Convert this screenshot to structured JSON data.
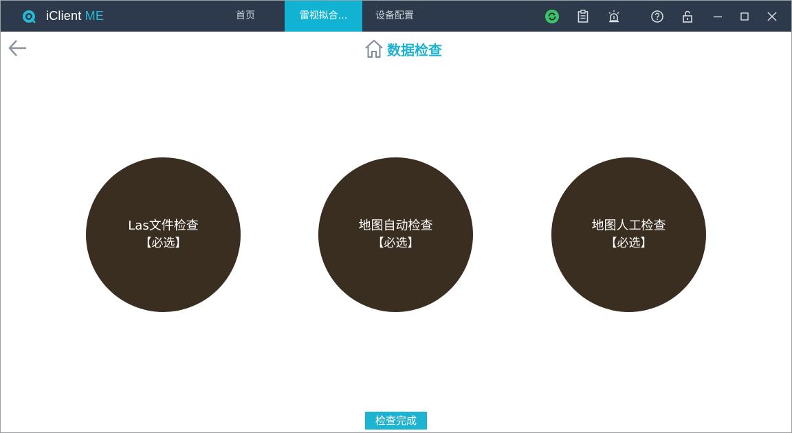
{
  "app": {
    "name_main": "iClient",
    "name_accent": "ME"
  },
  "tabs": [
    {
      "label": "首页",
      "active": false
    },
    {
      "label": "雷视拟合...",
      "active": true
    },
    {
      "label": "设备配置",
      "active": false
    }
  ],
  "toolbar_icons": [
    "sync-icon",
    "clipboard-icon",
    "alarm-icon",
    "help-icon",
    "lock-icon",
    "minimize-icon",
    "maximize-icon",
    "close-icon"
  ],
  "colors": {
    "titlebar": "#2c3a4b",
    "accent": "#1eb3d1",
    "circle": "#3a2e20",
    "sync_green": "#3cc36b"
  },
  "page": {
    "title": "数据检查"
  },
  "checks": [
    {
      "label": "Las文件检查",
      "sub": "【必选】"
    },
    {
      "label": "地图自动检查",
      "sub": "【必选】"
    },
    {
      "label": "地图人工检查",
      "sub": "【必选】"
    }
  ],
  "footer": {
    "done_label": "检查完成"
  }
}
